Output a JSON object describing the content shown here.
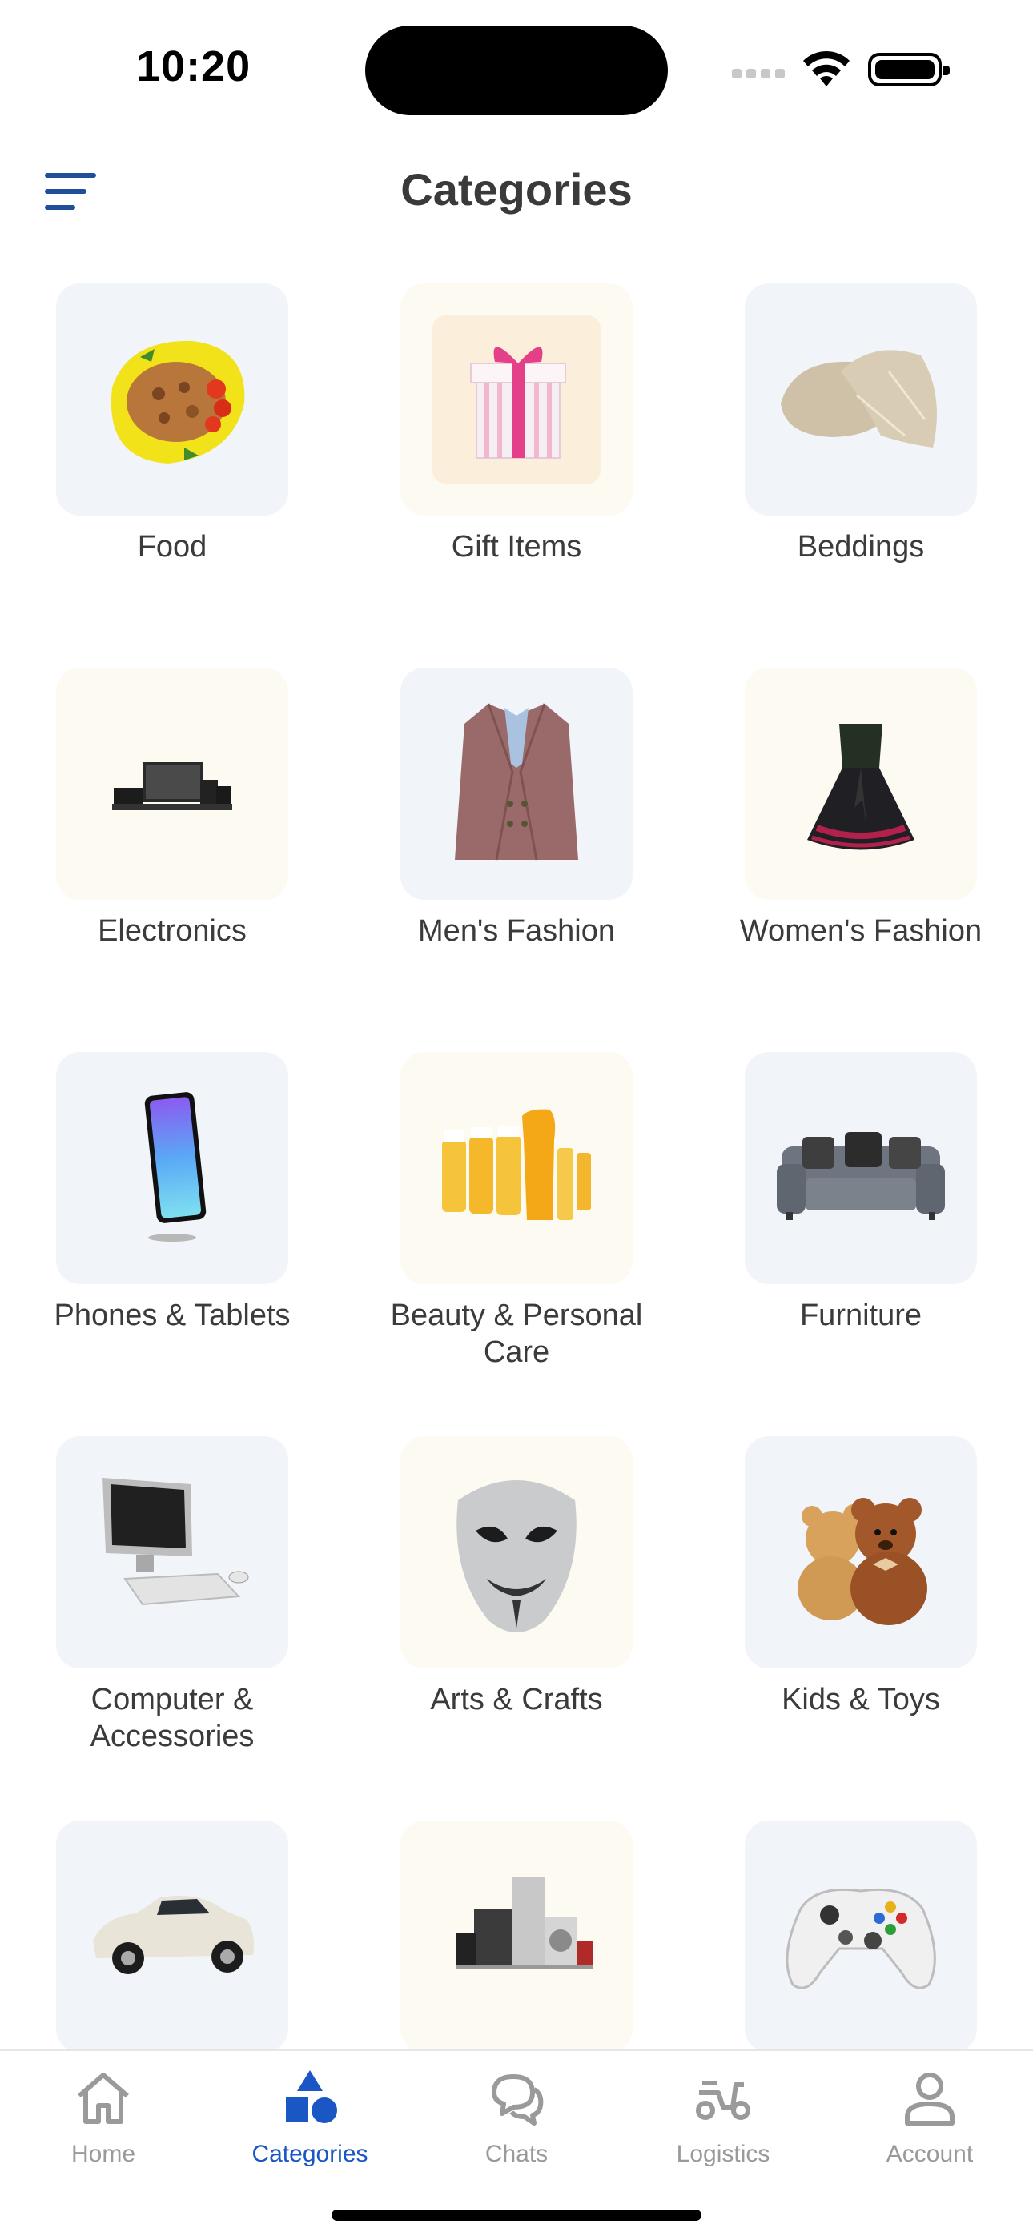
{
  "status": {
    "time": "10:20"
  },
  "header": {
    "title": "Categories"
  },
  "categories": [
    {
      "label": "Food",
      "icon": "food-icon",
      "tint": "blue"
    },
    {
      "label": "Gift Items",
      "icon": "gift-icon",
      "tint": "cream"
    },
    {
      "label": "Beddings",
      "icon": "pillows-icon",
      "tint": "blue"
    },
    {
      "label": "Electronics",
      "icon": "electronics-icon",
      "tint": "cream"
    },
    {
      "label": "Men's Fashion",
      "icon": "blazer-icon",
      "tint": "blue"
    },
    {
      "label": "Women's Fashion",
      "icon": "dress-icon",
      "tint": "cream"
    },
    {
      "label": "Phones & Tablets",
      "icon": "phone-icon",
      "tint": "blue"
    },
    {
      "label": "Beauty & Personal Care",
      "icon": "cosmetics-icon",
      "tint": "cream"
    },
    {
      "label": "Furniture",
      "icon": "sofa-icon",
      "tint": "blue"
    },
    {
      "label": "Computer & Accessories",
      "icon": "computer-icon",
      "tint": "blue"
    },
    {
      "label": "Arts & Crafts",
      "icon": "mask-icon",
      "tint": "cream"
    },
    {
      "label": "Kids & Toys",
      "icon": "teddy-bear-icon",
      "tint": "blue"
    },
    {
      "label": "",
      "icon": "car-icon",
      "tint": "blue"
    },
    {
      "label": "",
      "icon": "appliances-icon",
      "tint": "cream"
    },
    {
      "label": "",
      "icon": "game-controller-icon",
      "tint": "blue"
    }
  ],
  "nav": {
    "items": [
      {
        "label": "Home",
        "icon": "home-icon"
      },
      {
        "label": "Categories",
        "icon": "categories-icon",
        "active": true
      },
      {
        "label": "Chats",
        "icon": "chat-icon"
      },
      {
        "label": "Logistics",
        "icon": "scooter-icon"
      },
      {
        "label": "Account",
        "icon": "user-icon"
      }
    ]
  },
  "colors": {
    "accent": "#1a56c4",
    "tileBlue": "#f1f4f9",
    "tileCream": "#fdfaf1",
    "menuIcon": "#1f4e9c"
  }
}
